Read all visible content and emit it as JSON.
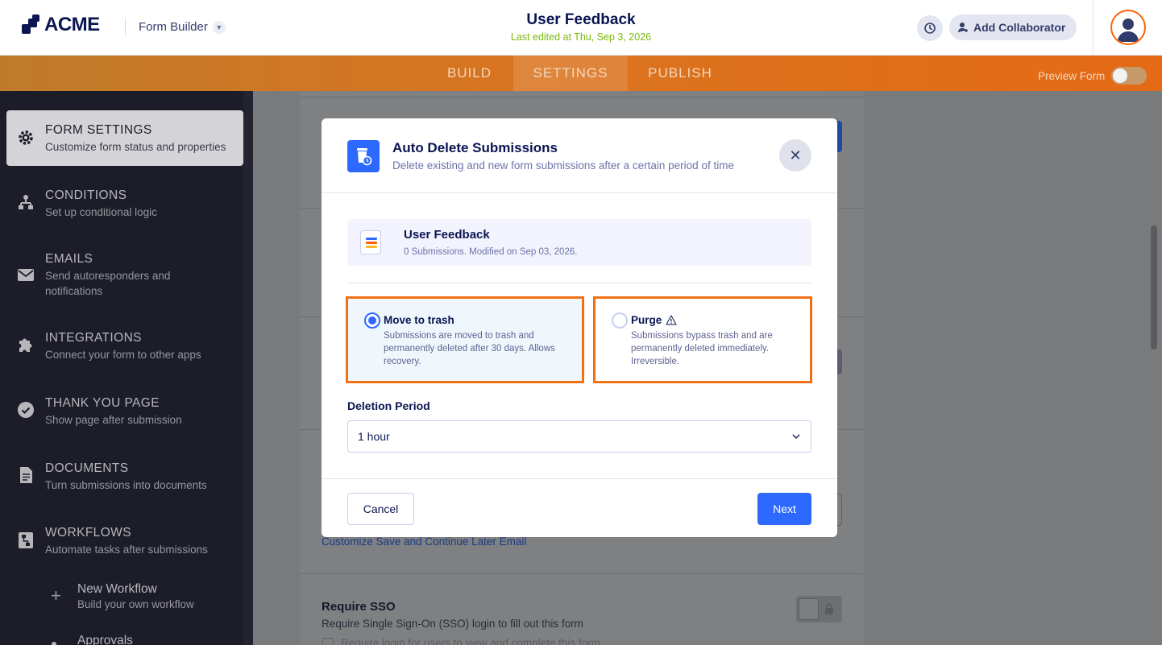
{
  "header": {
    "logo_text": "ACME",
    "form_builder_label": "Form Builder",
    "form_title": "User Feedback",
    "last_edited": "Last edited at Thu, Sep 3, 2026",
    "add_collaborator_label": "Add Collaborator"
  },
  "nav": {
    "tabs": [
      {
        "label": "BUILD"
      },
      {
        "label": "SETTINGS"
      },
      {
        "label": "PUBLISH"
      }
    ],
    "active_tab": "SETTINGS",
    "preview_label": "Preview Form",
    "preview_on": false
  },
  "sidebar": {
    "items": [
      {
        "title": "FORM SETTINGS",
        "desc": "Customize form status and properties",
        "icon": "gear-icon"
      },
      {
        "title": "CONDITIONS",
        "desc": "Set up conditional logic",
        "icon": "conditions-icon"
      },
      {
        "title": "EMAILS",
        "desc": "Send autoresponders and notifications",
        "icon": "envelope-icon"
      },
      {
        "title": "INTEGRATIONS",
        "desc": "Connect your form to other apps",
        "icon": "puzzle-icon"
      },
      {
        "title": "THANK YOU PAGE",
        "desc": "Show page after submission",
        "icon": "check-circle-icon"
      },
      {
        "title": "DOCUMENTS",
        "desc": "Turn submissions into documents",
        "icon": "document-icon"
      },
      {
        "title": "WORKFLOWS",
        "desc": "Automate tasks after submissions",
        "icon": "workflow-icon"
      }
    ],
    "sub_items": [
      {
        "title": "New Workflow",
        "desc": "Build your own workflow",
        "icon": "plus-icon"
      },
      {
        "title": "Approvals",
        "desc": "",
        "icon": "dot-icon"
      }
    ]
  },
  "background": {
    "customize_link": "Customize Save and Continue Later Email",
    "sso_title": "Require SSO",
    "sso_desc": "Require Single Sign-On (SSO) login to fill out this form",
    "sso_checkbox_label": "Require login for users to view and complete this form"
  },
  "modal": {
    "title": "Auto Delete Submissions",
    "subtitle": "Delete existing and new form submissions after a certain period of time",
    "form_name": "User Feedback",
    "form_meta": "0 Submissions. Modified on Sep 03, 2026.",
    "options": [
      {
        "title": "Move to trash",
        "desc": "Submissions are moved to trash and permanently deleted after 30 days. Allows recovery.",
        "selected": true
      },
      {
        "title": "Purge",
        "desc": "Submissions bypass trash and are permanently deleted immediately. Irreversible.",
        "selected": false,
        "icon": "warning-icon"
      }
    ],
    "period_label": "Deletion Period",
    "period_value": "1 hour",
    "cancel_label": "Cancel",
    "next_label": "Next"
  },
  "colors": {
    "accent": "#2e69ff",
    "highlight_border": "#f07014",
    "navbar": "#e46a16",
    "sidebar_bg": "#1c1d28"
  }
}
